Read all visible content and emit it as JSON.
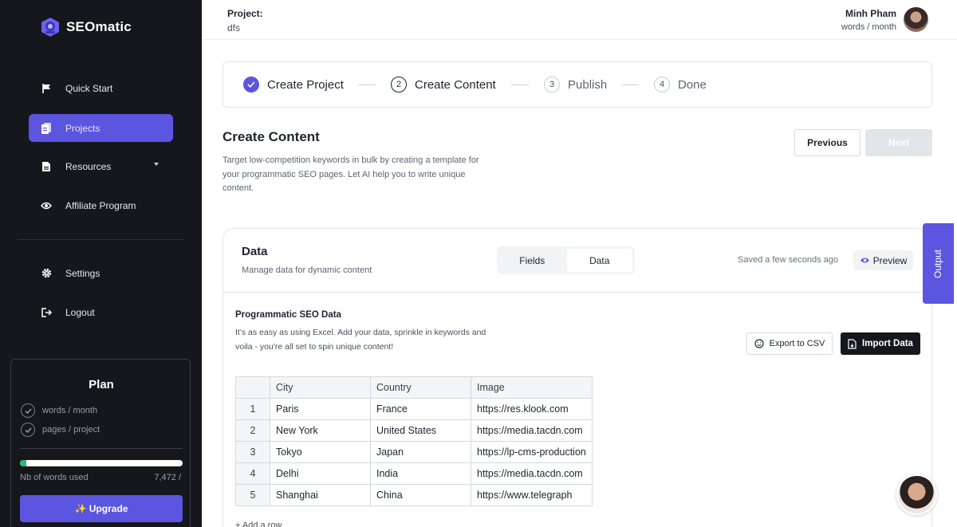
{
  "brand": {
    "name": "SEOmatic",
    "color": "#5b55e0"
  },
  "sidebar": {
    "items": [
      {
        "label": "Quick Start",
        "icon": "flag-icon"
      },
      {
        "label": "Projects",
        "icon": "document-icon",
        "active": true
      },
      {
        "label": "Resources",
        "icon": "file-icon",
        "has_submenu": true
      },
      {
        "label": "Affiliate Program",
        "icon": "eye-icon"
      }
    ],
    "bottom_items": [
      {
        "label": "Settings",
        "icon": "gear-icon"
      },
      {
        "label": "Logout",
        "icon": "logout-icon"
      }
    ]
  },
  "plan": {
    "title": "Plan",
    "features": [
      "words / month",
      "pages / project"
    ],
    "usage_label": "Nb of words used",
    "usage_value": "7,472 /",
    "usage_fraction": 0.04,
    "upgrade_label": "✨ Upgrade"
  },
  "header": {
    "project_label": "Project:",
    "project_name": "dfs",
    "user_name": "Minh Pham",
    "user_sub": "words / month"
  },
  "stepper": {
    "steps": [
      {
        "num": "",
        "label": "Create Project",
        "state": "done"
      },
      {
        "num": "2",
        "label": "Create Content",
        "state": "current"
      },
      {
        "num": "3",
        "label": "Publish",
        "state": "pending"
      },
      {
        "num": "4",
        "label": "Done",
        "state": "pending"
      }
    ]
  },
  "section": {
    "title": "Create Content",
    "description": "Target low-competition keywords in bulk by creating a template for your programmatic SEO pages.  Let AI help you to write unique content.",
    "previous_label": "Previous",
    "next_label": "Next"
  },
  "data_card": {
    "title": "Data",
    "subtitle": "Manage data for dynamic content",
    "tabs": [
      "Fields",
      "Data"
    ],
    "active_tab": "Data",
    "saved_text": "Saved a few seconds ago",
    "preview_label": "Preview",
    "prog_title": "Programmatic SEO Data",
    "prog_desc": "It's as easy as using Excel. Add your data, sprinkle in keywords and voila - you're all set to spin unique content!",
    "export_label": "Export to CSV",
    "import_label": "Import Data",
    "add_row_label": "+ Add a row"
  },
  "table": {
    "columns": [
      "City",
      "Country",
      "Image"
    ],
    "rows": [
      {
        "n": "1",
        "city": "Paris",
        "country": "France",
        "image": "https://res.klook.com"
      },
      {
        "n": "2",
        "city": "New York",
        "country": "United States",
        "image": "https://media.tacdn.com"
      },
      {
        "n": "3",
        "city": "Tokyo",
        "country": "Japan",
        "image": "https://lp-cms-production"
      },
      {
        "n": "4",
        "city": "Delhi",
        "country": "India",
        "image": "https://media.tacdn.com"
      },
      {
        "n": "5",
        "city": "Shanghai",
        "country": "China",
        "image": "https://www.telegraph"
      }
    ]
  },
  "output_tab_label": "Output"
}
